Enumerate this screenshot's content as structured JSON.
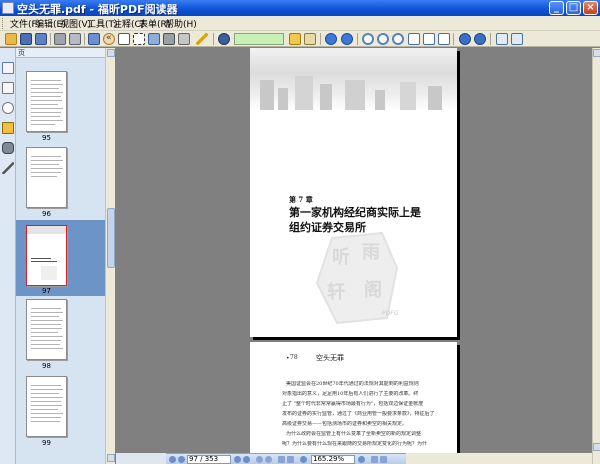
{
  "window": {
    "title": "空头无罪.pdf - 福昕PDF阅读器",
    "minimize_glyph": "_",
    "maximize_glyph": "□",
    "close_glyph": "×"
  },
  "menu": {
    "items": [
      {
        "label": "文件(F)"
      },
      {
        "label": "编辑(E)"
      },
      {
        "label": "视图(V)"
      },
      {
        "label": "工具(T)"
      },
      {
        "label": "注释(C)"
      },
      {
        "label": "表单(R)"
      },
      {
        "label": "帮助(H)"
      }
    ]
  },
  "toolbar": {
    "icons": [
      "open-icon",
      "save-icon",
      "save-as-icon",
      "print-icon",
      "print-preview-icon",
      "fullscreen-icon",
      "hand-tool-icon",
      "select-text-icon",
      "snapshot-icon",
      "image-tool-icon",
      "stamp-icon",
      "pencil-icon",
      "find-icon",
      "highlight-icon",
      "bookmark-add-icon",
      "back-arrow-icon",
      "forward-arrow-icon",
      "zoom-in-icon",
      "zoom-out-icon",
      "zoom-select-icon",
      "fit-page-icon",
      "fit-width-icon",
      "actual-size-icon",
      "rotate-left-icon",
      "rotate-right-icon",
      "single-page-icon",
      "continuous-page-icon"
    ],
    "find_value": ""
  },
  "sidebar": {
    "header": "页",
    "collapse_glyph": "«",
    "tabs": [
      "pages-tab-icon",
      "bookmarks-tab-icon",
      "annotations-tab-icon",
      "layers-tab-icon",
      "attachments-tab-icon",
      "signatures-tab-icon"
    ],
    "thumbnails": [
      {
        "label": "95",
        "selected": false
      },
      {
        "label": "96",
        "selected": false
      },
      {
        "label": "97",
        "selected": true
      },
      {
        "label": "98",
        "selected": false
      },
      {
        "label": "99",
        "selected": false
      }
    ]
  },
  "document": {
    "page1": {
      "chapter_number": "第 7 章",
      "chapter_title_line1": "第一家机构经纪商实际上是",
      "chapter_title_line2": "组约证券交易所",
      "watermark_chars": [
        "听",
        "雨",
        "轩",
        "阁"
      ],
      "watermark_footer": "PDFG"
    },
    "page2": {
      "header_bullet": "•",
      "header_number": "78",
      "header_title": "空头无罪",
      "lines": [
        "美国证监会在20世纪70年代通过的法规对其能到的利益规则",
        "对象指出的意义，足足用10年后有人们进行了主要的改革。终",
        "止了 \"整个时代非常常赢得市场最有行为\"，包括双边保证金帐度",
        "发布的证券的实行监管，通过了《商业用管一般要求条款》，特征后了",
        "高级证券交易——包括测场市的证券和卖空的相关规定。",
        "为什么政府会在监管上有什么变革了全新卖空的新的规定调整",
        "呢？为什么要有什么现在来跟随的交易所规定变化的行为呢？为什"
      ]
    }
  },
  "navigation": {
    "page_field": "97 / 353",
    "zoom_value": "165.29%"
  }
}
